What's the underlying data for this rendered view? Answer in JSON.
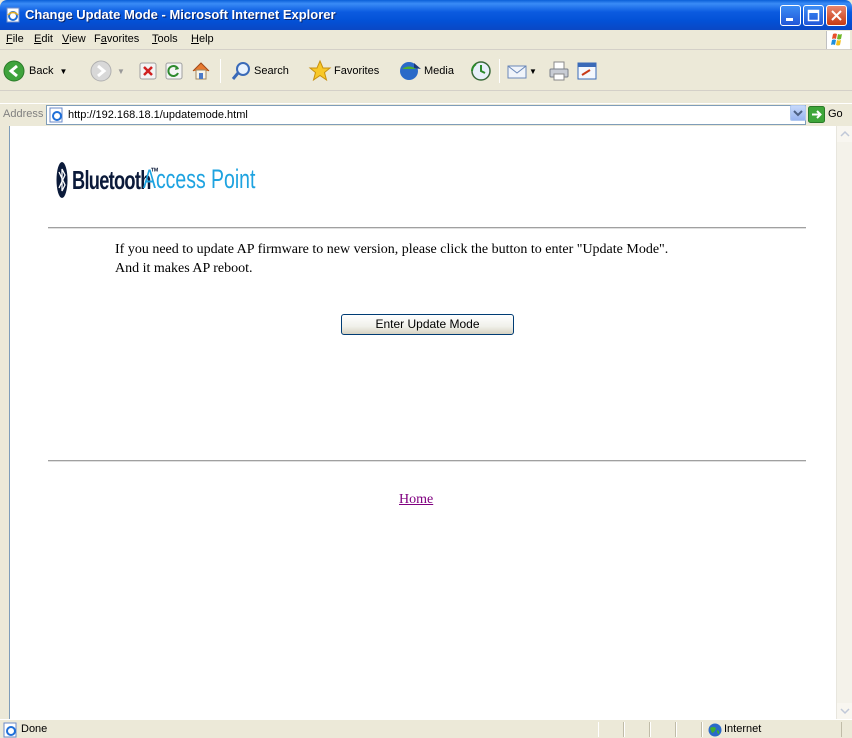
{
  "window": {
    "title": "Change Update Mode - Microsoft Internet Explorer"
  },
  "menu": {
    "file": {
      "u": "F",
      "rest": "ile"
    },
    "edit": {
      "u": "E",
      "rest": "dit"
    },
    "view": {
      "u": "V",
      "rest": "iew"
    },
    "favorites": {
      "pre": "F",
      "u": "a",
      "rest": "vorites"
    },
    "tools": {
      "u": "T",
      "rest": "ools"
    },
    "help": {
      "u": "H",
      "rest": "elp"
    }
  },
  "toolbar": {
    "back": "Back",
    "search": "Search",
    "favorites": "Favorites",
    "media": "Media"
  },
  "address": {
    "label": "Address",
    "url": "http://192.168.18.1/updatemode.html",
    "go": "Go"
  },
  "page": {
    "logo_bluetooth": "Bluetooth",
    "logo_tm": "™",
    "logo_access_point": "Access Point",
    "message_line1": "If you need to update AP firmware to new version, please click the button to enter \"Update Mode\".",
    "message_line2": "And it makes AP  reboot.",
    "update_button": "Enter Update Mode",
    "home_link": "Home"
  },
  "status": {
    "text": "Done",
    "zone": "Internet"
  },
  "colors": {
    "titlebar": "#0351D6",
    "logo_dark": "#0B1A3A",
    "logo_accent": "#1EA3E0",
    "visited_link": "#800080"
  }
}
